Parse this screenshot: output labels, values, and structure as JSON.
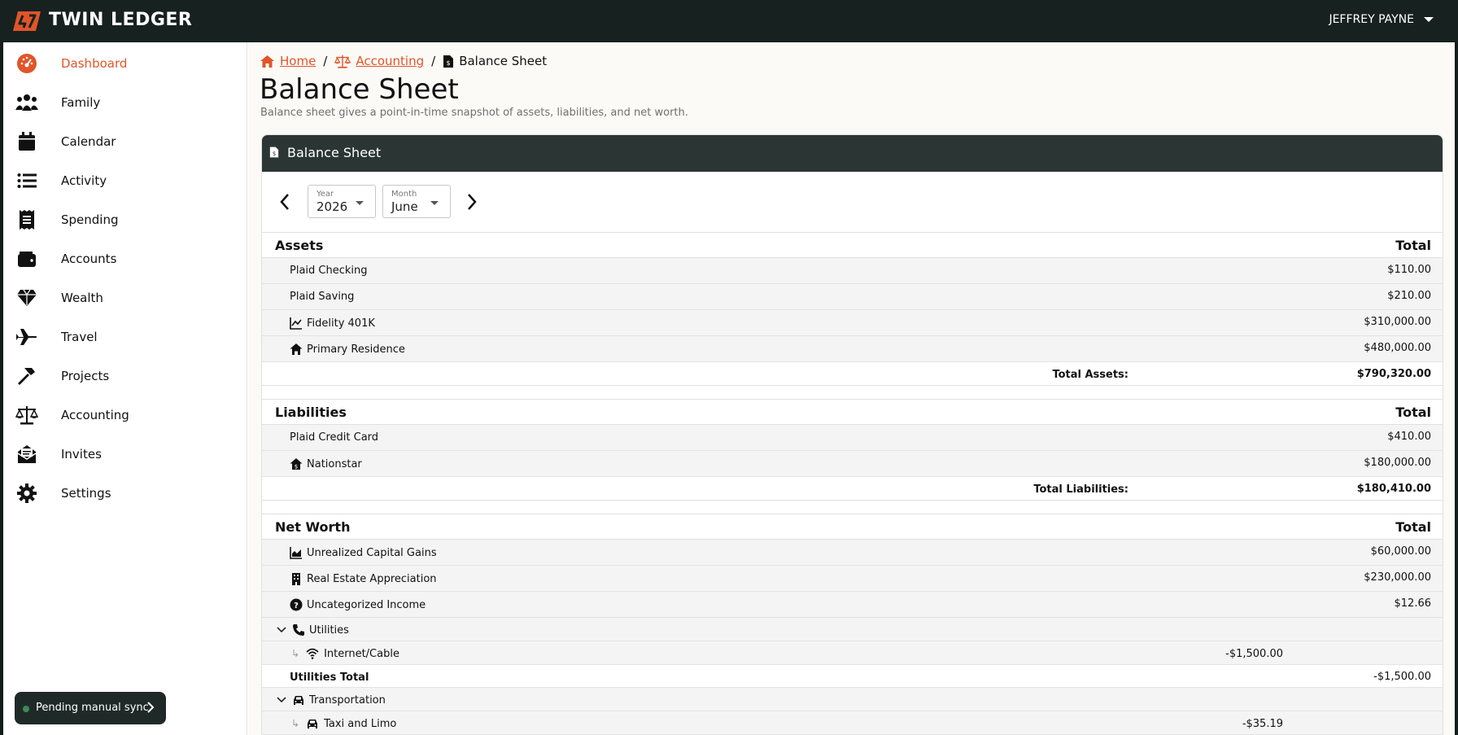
{
  "app": {
    "brand": "TWIN LEDGER",
    "user": "JEFFREY PAYNE",
    "accent": "#e0552a"
  },
  "sidebar": {
    "items": [
      {
        "label": "Dashboard",
        "icon": "dashboard-icon",
        "active": true
      },
      {
        "label": "Family",
        "icon": "users-icon"
      },
      {
        "label": "Calendar",
        "icon": "calendar-icon"
      },
      {
        "label": "Activity",
        "icon": "list-icon"
      },
      {
        "label": "Spending",
        "icon": "receipt-icon"
      },
      {
        "label": "Accounts",
        "icon": "wallet-icon"
      },
      {
        "label": "Wealth",
        "icon": "gem-icon"
      },
      {
        "label": "Travel",
        "icon": "plane-icon"
      },
      {
        "label": "Projects",
        "icon": "hammer-icon"
      },
      {
        "label": "Accounting",
        "icon": "scale-icon"
      },
      {
        "label": "Invites",
        "icon": "envelope-icon"
      },
      {
        "label": "Settings",
        "icon": "gear-icon"
      }
    ],
    "sync_label": "Pending manual sync"
  },
  "breadcrumb": {
    "home": "Home",
    "accounting": "Accounting",
    "current": "Balance Sheet"
  },
  "page": {
    "title": "Balance Sheet",
    "subtitle": "Balance sheet gives a point-in-time snapshot of assets, liabilities, and net worth."
  },
  "card": {
    "title": "Balance Sheet",
    "year_label": "Year",
    "year_value": "2026",
    "month_label": "Month",
    "month_value": "June"
  },
  "assets": {
    "title": "Assets",
    "total_header": "Total",
    "rows": [
      {
        "label": "Plaid Checking",
        "value": "$110.00"
      },
      {
        "label": "Plaid Saving",
        "value": "$210.00"
      },
      {
        "label": "Fidelity 401K",
        "value": "$310,000.00",
        "icon": "chart-line-icon"
      },
      {
        "label": "Primary Residence",
        "value": "$480,000.00",
        "icon": "house-icon"
      }
    ],
    "total_label": "Total Assets:",
    "total_value": "$790,320.00"
  },
  "liabilities": {
    "title": "Liabilities",
    "total_header": "Total",
    "rows": [
      {
        "label": "Plaid Credit Card",
        "value": "$410.00"
      },
      {
        "label": "Nationstar",
        "value": "$180,000.00",
        "icon": "house-mortgage-icon"
      }
    ],
    "total_label": "Total Liabilities:",
    "total_value": "$180,410.00"
  },
  "net_worth": {
    "title": "Net Worth",
    "total_header": "Total",
    "rows": [
      {
        "label": "Unrealized Capital Gains",
        "value": "$60,000.00",
        "icon": "chart-area-icon"
      },
      {
        "label": "Real Estate Appreciation",
        "value": "$230,000.00",
        "icon": "building-icon"
      },
      {
        "label": "Uncategorized Income",
        "value": "$12.66",
        "icon": "question-circle-icon"
      }
    ],
    "utilities": {
      "label": "Utilities",
      "child_label": "Internet/Cable",
      "child_value": "-$1,500.00",
      "total_label": "Utilities Total",
      "total_value": "-$1,500.00"
    },
    "transportation": {
      "label": "Transportation",
      "child_label": "Taxi and Limo",
      "child_value": "-$35.19"
    }
  }
}
